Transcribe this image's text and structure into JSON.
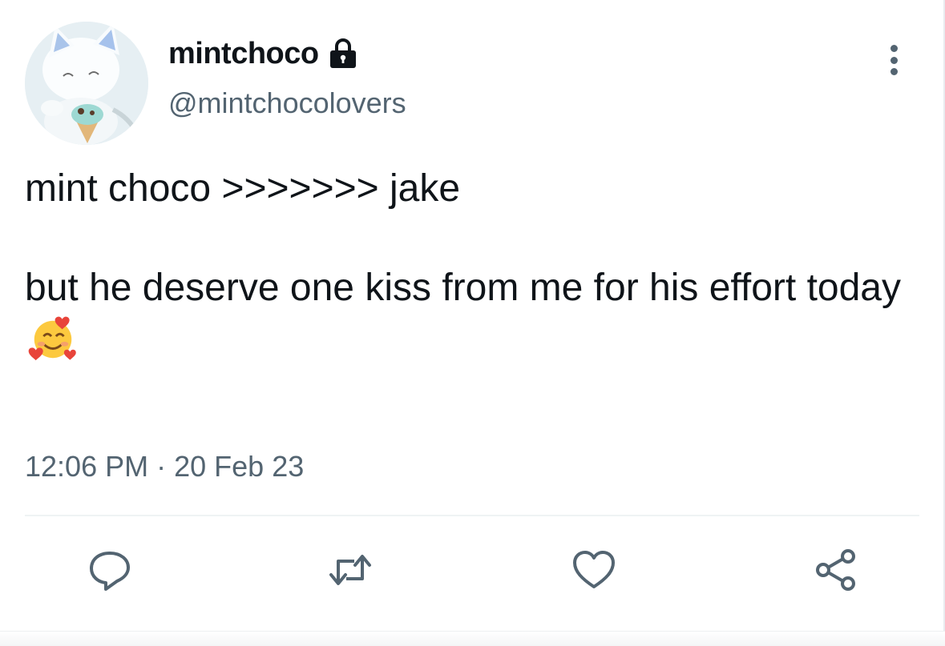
{
  "tweet": {
    "display_name": "mintchoco",
    "handle": "@mintchocolovers",
    "protected_icon": "lock-icon",
    "text_line1": "mint choco >>>>>>> jake",
    "text_line2": "but he deserve one kiss from me for his effort today",
    "emoji": "smiling-face-with-hearts",
    "time": "12:06 PM",
    "date_separator": "·",
    "date": "20 Feb 23"
  },
  "actions": [
    {
      "name": "reply",
      "icon": "reply-icon"
    },
    {
      "name": "retweet",
      "icon": "retweet-icon"
    },
    {
      "name": "like",
      "icon": "heart-icon"
    },
    {
      "name": "share",
      "icon": "share-icon"
    }
  ],
  "colors": {
    "text_primary": "#0f1419",
    "text_secondary": "#536471",
    "divider": "#eff3f4"
  }
}
